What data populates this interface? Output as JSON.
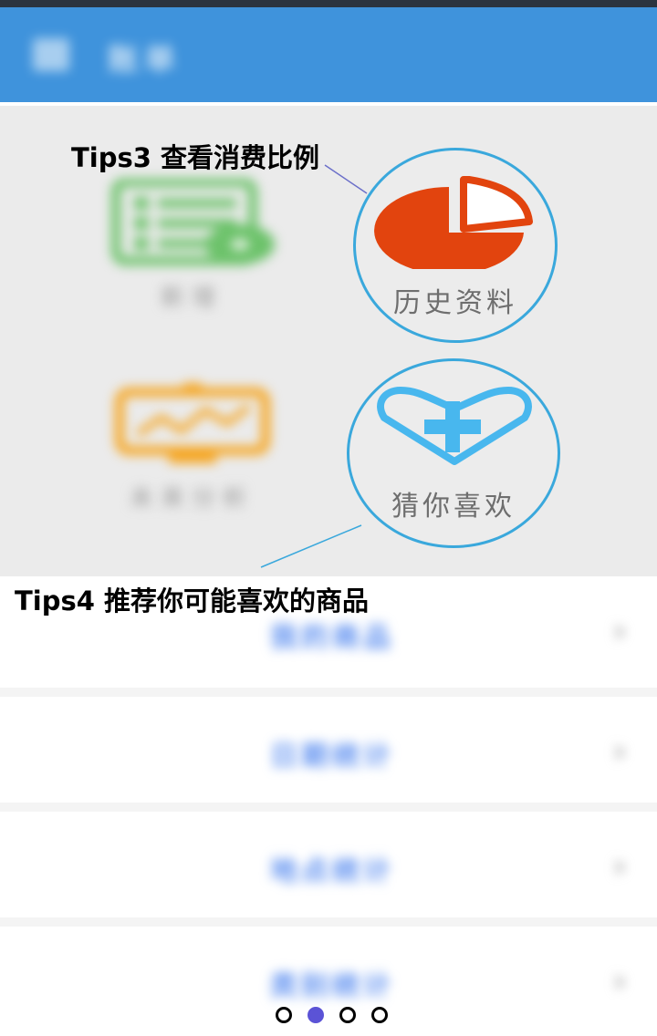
{
  "app_bar": {
    "title": "账单",
    "color": "#3f93dc"
  },
  "tiles": {
    "add": {
      "label": "新增",
      "icon": "spreadsheet-add-icon",
      "color": "#6cc26a"
    },
    "analysis": {
      "label": "未来分析",
      "icon": "trend-chart-icon",
      "color": "#f5a623"
    },
    "history": {
      "label": "历史资料",
      "icon": "pie-chart-icon",
      "color": "#e2440e"
    },
    "guess": {
      "label": "猜你喜欢",
      "icon": "heart-plus-icon",
      "color": "#48b7ee"
    }
  },
  "tips": {
    "tip3": "Tips3 查看消费比例",
    "tip4": "Tips4 推荐你可能喜欢的商品"
  },
  "list": {
    "items": [
      {
        "label": "我的商品"
      },
      {
        "label": "日期统计"
      },
      {
        "label": "地点统计"
      },
      {
        "label": "类别统计"
      }
    ],
    "text_color": "#5b8ef0"
  },
  "pager": {
    "total": 4,
    "active_index": 1,
    "active_color": "#5b53d6"
  }
}
